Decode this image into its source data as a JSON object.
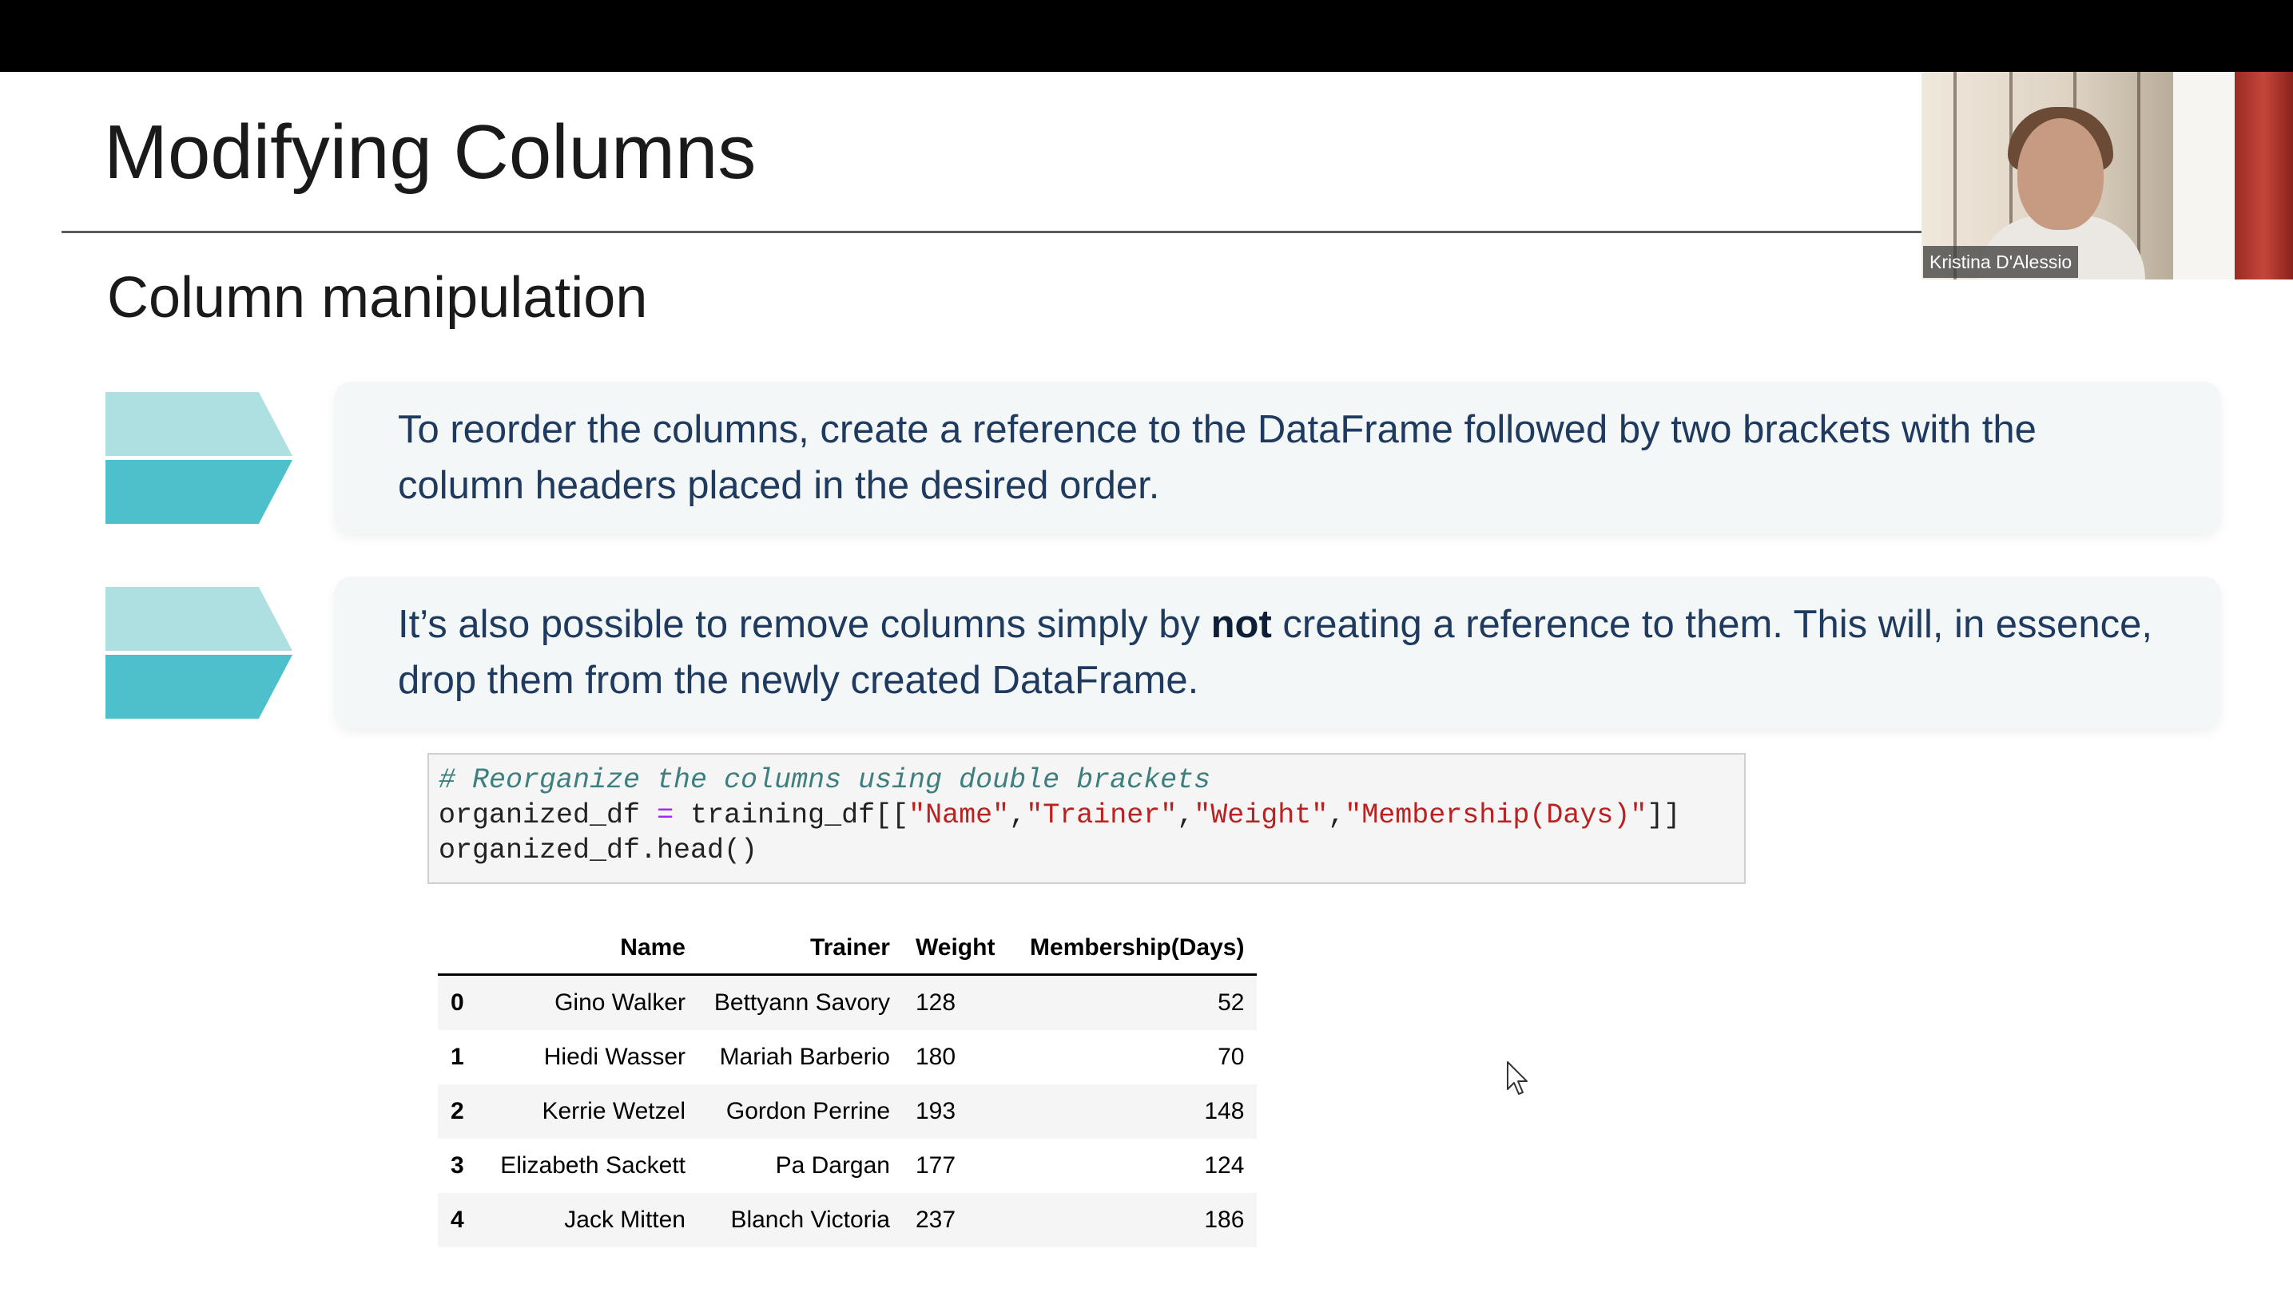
{
  "slide": {
    "title": "Modifying Columns",
    "subtitle": "Column manipulation",
    "bullet1": "To reorder the columns, create a reference to the DataFrame followed by two brackets with the column headers placed in the desired order.",
    "bullet2_before": "It’s also possible to remove columns simply by ",
    "bullet2_bold": "not",
    "bullet2_after": " creating a reference to them. This will, in essence, drop them from the newly created DataFrame."
  },
  "code": {
    "comment": "# Reorganize the columns using double brackets",
    "line2_var": "organized_df",
    "line2_op": "=",
    "line2_call": "training_df[[",
    "line2_strings": [
      "\"Name\"",
      "\"Trainer\"",
      "\"Weight\"",
      "\"Membership(Days)\""
    ],
    "line2_sep": ",",
    "line2_close": "]]",
    "line3": "organized_df.head()"
  },
  "table": {
    "columns": [
      "",
      "Name",
      "Trainer",
      "Weight",
      "Membership(Days)"
    ],
    "rows": [
      [
        "0",
        "Gino Walker",
        "Bettyann Savory",
        "128",
        "52"
      ],
      [
        "1",
        "Hiedi Wasser",
        "Mariah Barberio",
        "180",
        "70"
      ],
      [
        "2",
        "Kerrie Wetzel",
        "Gordon Perrine",
        "193",
        "148"
      ],
      [
        "3",
        "Elizabeth Sackett",
        "Pa Dargan",
        "177",
        "124"
      ],
      [
        "4",
        "Jack Mitten",
        "Blanch Victoria",
        "237",
        "186"
      ]
    ]
  },
  "webcam": {
    "participant_name": "Kristina D'Alessio"
  },
  "icons": {
    "bullet_marker": "chevron-arrow-icon",
    "cursor": "mouse-pointer-icon"
  },
  "colors": {
    "chevron_light": "#aee0e2",
    "chevron_dark": "#4ec0cc",
    "bullet_text": "#1f3a5f",
    "code_string": "#ba2121",
    "code_comment": "#3d7f7f"
  }
}
